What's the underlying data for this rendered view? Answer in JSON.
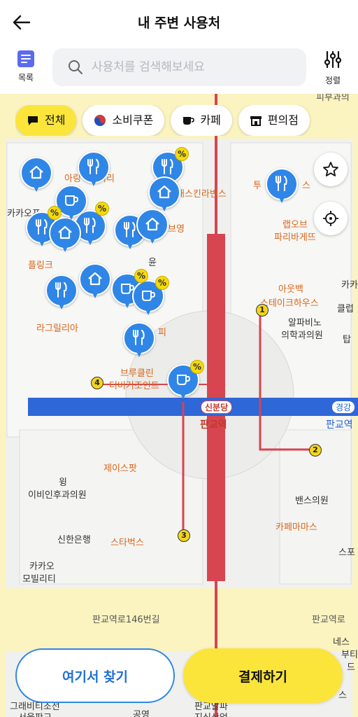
{
  "header": {
    "title": "내 주변 사용처"
  },
  "toolbar": {
    "list_label": "목록",
    "sort_label": "정렬",
    "search_placeholder": "사용처를 검색해보세요"
  },
  "categories": [
    {
      "label": "전체",
      "icon": "speech-bubble-icon",
      "active": true
    },
    {
      "label": "소비쿠폰",
      "icon": "taegeuk-icon",
      "active": false
    },
    {
      "label": "카페",
      "icon": "coffee-cup-icon",
      "active": false
    },
    {
      "label": "편의점",
      "icon": "store-icon",
      "active": false
    }
  ],
  "map": {
    "places": {
      "pibu": "피부과의",
      "kakao_fr": "카카오프",
      "aring": "아링",
      "kuri": "커리",
      "baskin": "배스킨라빈스",
      "tu": "투",
      "su": "스",
      "young": "브영",
      "lab": "랩오브",
      "paris": "파리바게뜨",
      "yun": "윤",
      "fling": "플링크",
      "outback": "아웃백",
      "steakhouse": "스테이크하우스",
      "kaka_right": "카카",
      "club": "클럽",
      "t_right": "탑",
      "lagrilia": "라그릴리아",
      "alpha": "알파비노",
      "alpha_clinic": "의학과의원",
      "coffee_p": "피",
      "bruklin": "브루클린",
      "burgerjoint": "더버거조인트",
      "shinbundang": "신분당",
      "pangyo_stn": "판교역",
      "gyeonggang": "경강",
      "pangyo_right": "판교역",
      "jace": "제이스팟",
      "wing": "윙",
      "ivy": "이비인후과의원",
      "shinhan": "신한은행",
      "starbucks": "스타벅스",
      "kakao_mob1": "카카오",
      "kakao_mob2": "모빌리티",
      "bans": "밴스의원",
      "cafemamas": "카페마마스",
      "spo": "스포",
      "road": "판교역로146번길",
      "road_right": "판교역로",
      "nes": "네스",
      "bu": "부티",
      "de": "드",
      "grand1": "그래비티조선",
      "grand2": "서울판교",
      "park": "공영",
      "pangyo_al": "판교알파",
      "jisik": "지식산업",
      "right_bottom": "스"
    },
    "exit_numbers": [
      "1",
      "2",
      "3",
      "4"
    ]
  },
  "actions": {
    "search_here": "여기서 찾기",
    "pay": "결제하기"
  },
  "colors": {
    "accent_yellow": "#fbe53b",
    "pin_blue": "#2f86e6",
    "line_red": "#d64550",
    "line_blue": "#2e67d8"
  }
}
